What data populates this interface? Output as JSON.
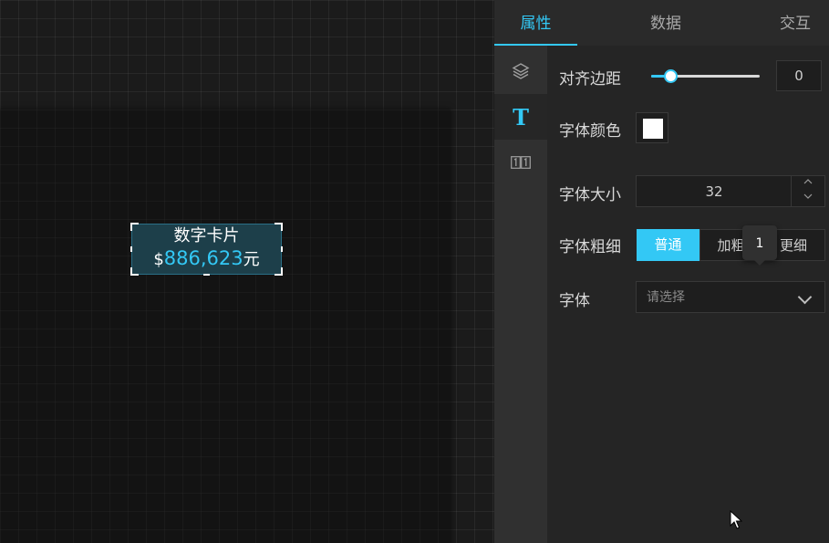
{
  "card": {
    "title": "数字卡片",
    "prefix": "$",
    "value": "886,623",
    "suffix": "元"
  },
  "tabs": [
    {
      "label": "属性",
      "active": true
    },
    {
      "label": "数据",
      "active": false
    },
    {
      "label": "交互",
      "active": false
    }
  ],
  "side_icons": [
    {
      "name": "layers-icon",
      "active": false
    },
    {
      "name": "text-style-icon",
      "glyph": "T",
      "active": true
    },
    {
      "name": "number-icon",
      "glyph": "1̲1̲",
      "active": false
    }
  ],
  "form": {
    "padding": {
      "label": "对齐边距",
      "value": "0",
      "slider_fraction": 0.17
    },
    "font_color": {
      "label": "字体颜色",
      "color": "#ffffff"
    },
    "font_size": {
      "label": "字体大小",
      "value": "32"
    },
    "font_weight": {
      "label": "字体粗细",
      "options": [
        "普通",
        "加粗",
        "更细"
      ],
      "selected": "普通",
      "tooltip": "1"
    },
    "font_family": {
      "label": "字体",
      "placeholder": "请选择"
    }
  },
  "colors": {
    "accent": "#33c8f5",
    "panel": "#252525",
    "canvas": "#1b1b1b"
  }
}
